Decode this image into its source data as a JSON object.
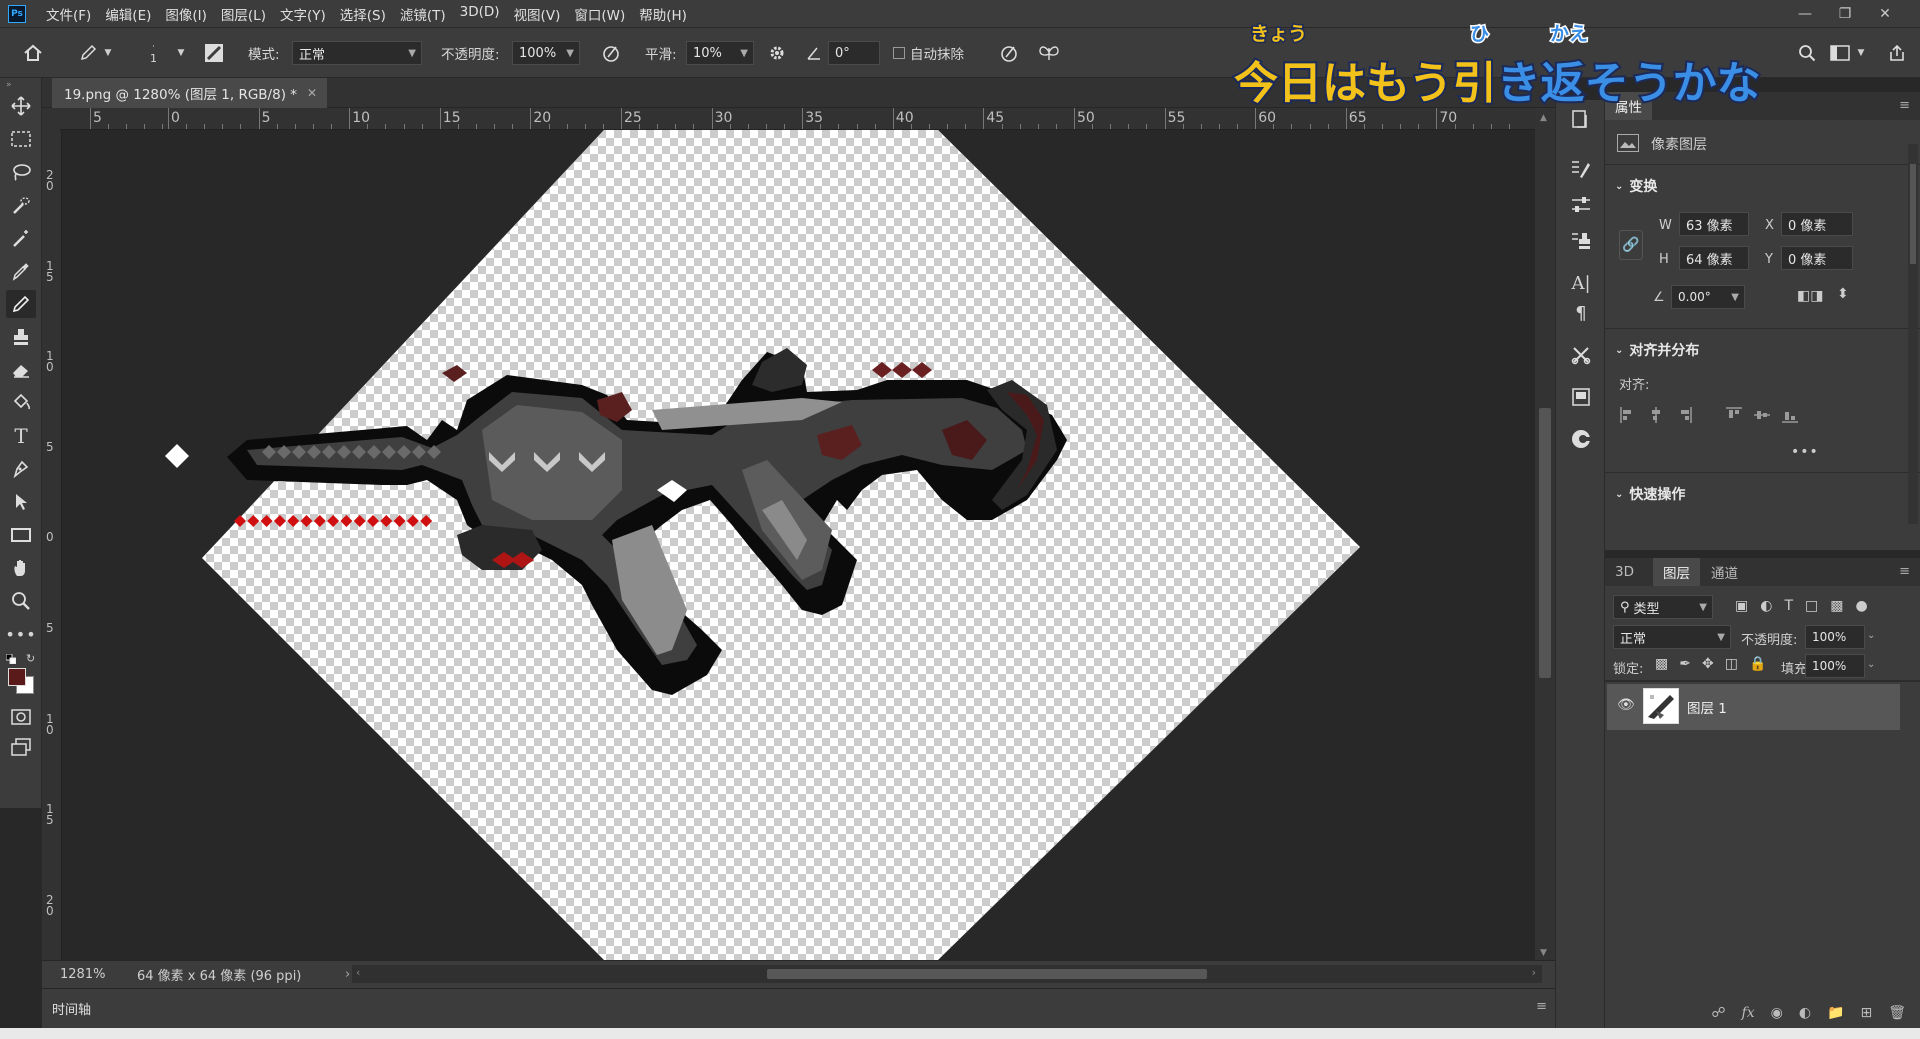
{
  "app": {
    "logo": "Ps"
  },
  "menu": [
    "文件(F)",
    "编辑(E)",
    "图像(I)",
    "图层(L)",
    "文字(Y)",
    "选择(S)",
    "滤镜(T)",
    "3D(D)",
    "视图(V)",
    "窗口(W)",
    "帮助(H)"
  ],
  "options": {
    "brush_size": "1",
    "mode_label": "模式:",
    "mode_value": "正常",
    "opacity_label": "不透明度:",
    "opacity_value": "100%",
    "smooth_label": "平滑:",
    "smooth_value": "10%",
    "angle_value": "0°",
    "auto_erase_label": "自动抹除"
  },
  "document": {
    "tab_title": "19.png @ 1280% (图层 1, RGB/8) *"
  },
  "ruler": {
    "h_labels": [
      "5",
      "0",
      "5",
      "10",
      "15",
      "20",
      "25",
      "30",
      "35",
      "40",
      "45",
      "50",
      "55",
      "60",
      "65",
      "70"
    ],
    "v_labels": [
      "2 0",
      "1 5",
      "1 0",
      "5",
      "0",
      "5",
      "1 0",
      "1 5",
      "2 0"
    ]
  },
  "status": {
    "zoom": "1281%",
    "doc_info": "64 像素 x 64 像素 (96 ppi)"
  },
  "timeline": {
    "label": "时间轴"
  },
  "caption": {
    "text": "今日はもう引き返そうかな",
    "furigana": [
      "きょう",
      "ひ",
      "かえ"
    ],
    "colors": {
      "yellow": "#f2c21b",
      "blue": "#3a8ee6",
      "outline": "#1c2a5a"
    }
  },
  "properties": {
    "tab": "属性",
    "layer_type": "像素图层",
    "transform_title": "变换",
    "w_label": "W",
    "w_value": "63 像素",
    "h_label": "H",
    "h_value": "64 像素",
    "x_label": "X",
    "x_value": "0 像素",
    "y_label": "Y",
    "y_value": "0 像素",
    "angle_value": "0.00°",
    "align_title": "对齐并分布",
    "align_label": "对齐:",
    "quick_title": "快速操作"
  },
  "layers": {
    "tabs": [
      "3D",
      "图层",
      "通道"
    ],
    "active_tab": "图层",
    "filter_label": "类型",
    "blend_mode": "正常",
    "opacity_label": "不透明度:",
    "opacity_value": "100%",
    "lock_label": "锁定:",
    "fill_label": "填充:",
    "fill_value": "100%",
    "layer_name": "图层 1"
  },
  "colors": {
    "foreground": "#5a1a1a",
    "background": "#ffffff",
    "accent_red": "#d01010"
  }
}
